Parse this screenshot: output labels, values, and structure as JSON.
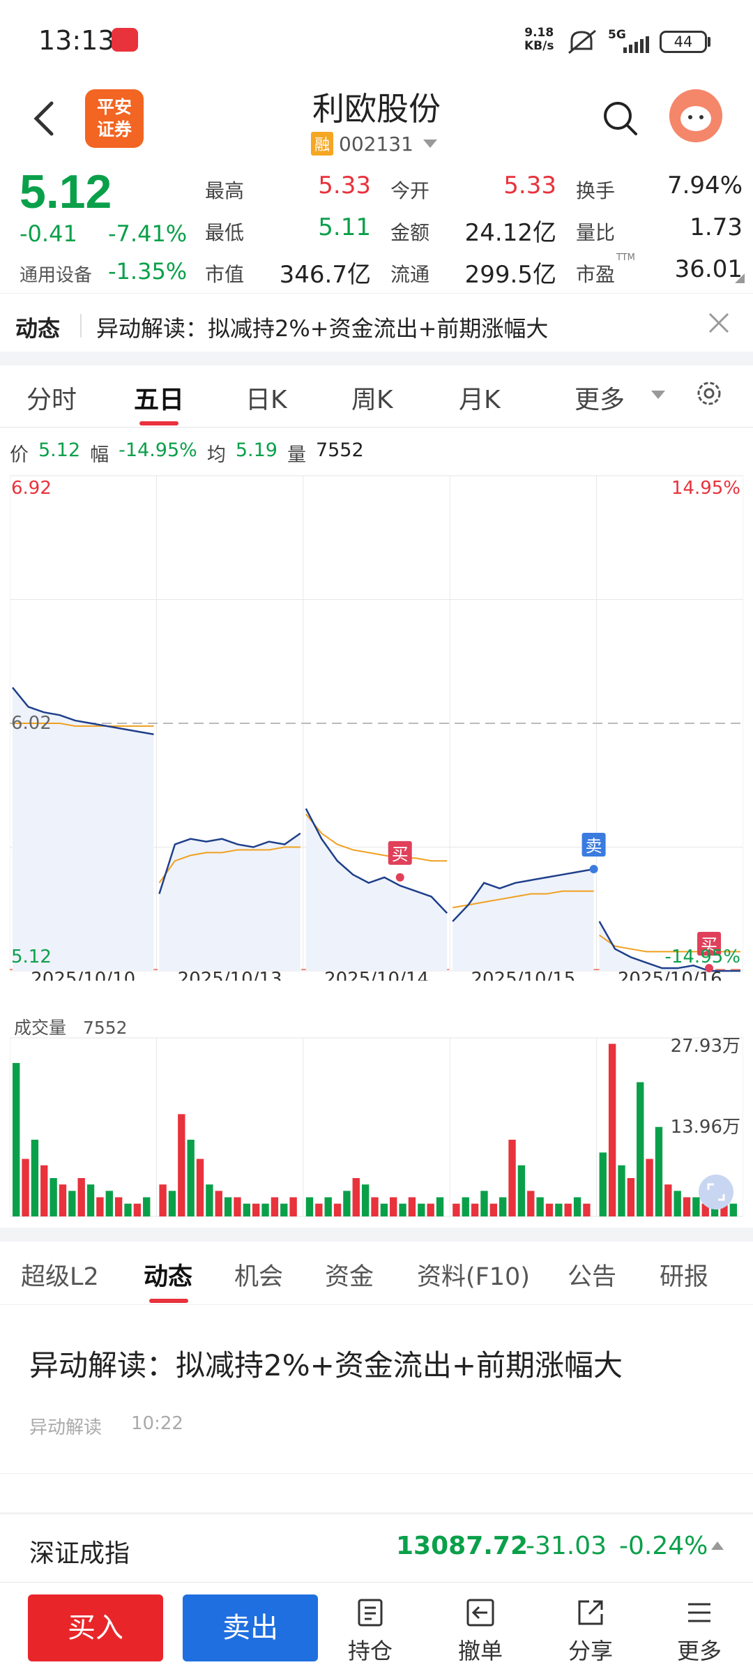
{
  "status": {
    "time": "13:13",
    "net_speed_value": "9.18",
    "net_speed_unit": "KB/s",
    "network": "5G",
    "battery": "44"
  },
  "header": {
    "broker_logo": "平安证券",
    "stock_name": "利欧股份",
    "margin_badge": "融",
    "stock_code": "002131"
  },
  "quote": {
    "price": "5.12",
    "change": "-0.41",
    "change_pct": "-7.41%",
    "sector": "通用设备",
    "sector_pct": "-1.35%",
    "stats": [
      {
        "label": "最高",
        "value": "5.33"
      },
      {
        "label": "今开",
        "value": "5.33"
      },
      {
        "label": "换手",
        "value": "7.94%"
      },
      {
        "label": "最低",
        "value": "5.11"
      },
      {
        "label": "金额",
        "value": "24.12亿"
      },
      {
        "label": "量比",
        "value": "1.73"
      },
      {
        "label": "市值",
        "value": "346.7亿"
      },
      {
        "label": "流通",
        "value": "299.5亿"
      },
      {
        "label": "市盈",
        "value": "36.01"
      }
    ],
    "pe_superscript": "TTM"
  },
  "news_strip": {
    "tag": "动态",
    "text": "异动解读：拟减持2%+资金流出+前期涨幅大"
  },
  "chart_tabs": [
    "分时",
    "五日",
    "日K",
    "周K",
    "月K",
    "更多"
  ],
  "chart_info": {
    "price_label": "价",
    "price": "5.12",
    "range_label": "幅",
    "range": "-14.95%",
    "avg_label": "均",
    "avg": "5.19",
    "vol_label": "量",
    "vol": "7552"
  },
  "colors": {
    "up": "#e8323c",
    "down": "#0aa04a",
    "price_line": "#1e3f8a",
    "avg_line": "#f0a020",
    "buy": "#e8262a",
    "sell": "#1f6fe0"
  },
  "chart_data": [
    {
      "type": "line",
      "title": "",
      "x_labels": [
        "2025/10/10",
        "2025/10/13",
        "2025/10/14",
        "2025/10/15",
        "2025/10/16"
      ],
      "ylim": [
        5.12,
        6.92
      ],
      "y_tick_labels": [
        "6.92",
        "6.02",
        "5.12"
      ],
      "right_tick_labels": [
        "14.95%",
        "-14.95%"
      ],
      "reference_price": 6.02,
      "series": [
        {
          "name": "价",
          "values_by_day": [
            [
              6.15,
              6.08,
              6.06,
              6.05,
              6.03,
              6.02,
              6.01,
              6.0,
              5.99,
              5.98
            ],
            [
              5.4,
              5.58,
              5.6,
              5.59,
              5.6,
              5.58,
              5.57,
              5.59,
              5.58,
              5.62
            ],
            [
              5.71,
              5.6,
              5.52,
              5.47,
              5.44,
              5.46,
              5.43,
              5.41,
              5.39,
              5.33
            ],
            [
              5.3,
              5.36,
              5.44,
              5.42,
              5.44,
              5.45,
              5.46,
              5.47,
              5.48,
              5.49
            ],
            [
              5.3,
              5.2,
              5.17,
              5.15,
              5.13,
              5.13,
              5.14,
              5.12,
              5.12,
              5.12
            ]
          ]
        },
        {
          "name": "均",
          "values_by_day": [
            [
              6.02,
              6.02,
              6.02,
              6.02,
              6.01,
              6.01,
              6.01,
              6.01,
              6.01,
              6.01
            ],
            [
              5.44,
              5.52,
              5.54,
              5.55,
              5.55,
              5.56,
              5.56,
              5.56,
              5.57,
              5.57
            ],
            [
              5.69,
              5.62,
              5.58,
              5.56,
              5.55,
              5.54,
              5.53,
              5.53,
              5.52,
              5.52
            ],
            [
              5.35,
              5.36,
              5.37,
              5.38,
              5.39,
              5.4,
              5.4,
              5.41,
              5.41,
              5.41
            ],
            [
              5.25,
              5.21,
              5.2,
              5.19,
              5.19,
              5.19,
              5.19,
              5.19,
              5.19,
              5.19
            ]
          ]
        }
      ],
      "markers": [
        {
          "label": "买",
          "day": 2,
          "index": 6,
          "value": 5.46
        },
        {
          "label": "卖",
          "day": 3,
          "index": 9,
          "value": 5.49
        },
        {
          "label": "买",
          "day": 4,
          "index": 7,
          "value": 5.13
        }
      ]
    },
    {
      "type": "bar",
      "title": "成交量",
      "current_volume": "7552",
      "y_tick_labels": [
        "27.93万",
        "13.96万"
      ],
      "ylim": [
        0,
        27.93
      ],
      "unit": "万",
      "days": 5,
      "values": [
        [
          24,
          9,
          12,
          8,
          6,
          5,
          4,
          6,
          5,
          3,
          4,
          3,
          2,
          2,
          3
        ],
        [
          5,
          4,
          16,
          12,
          9,
          5,
          4,
          3,
          3,
          2,
          2,
          2,
          3,
          2,
          3
        ],
        [
          3,
          2,
          3,
          2,
          4,
          6,
          5,
          3,
          2,
          3,
          2,
          3,
          2,
          2,
          3
        ],
        [
          2,
          3,
          2,
          4,
          2,
          3,
          12,
          8,
          4,
          3,
          2,
          2,
          2,
          3,
          2
        ],
        [
          10,
          27,
          8,
          6,
          21,
          9,
          14,
          5,
          4,
          3,
          3,
          2,
          3,
          2,
          2
        ]
      ]
    }
  ],
  "bottom_tabs": [
    "超级L2",
    "动态",
    "机会",
    "资金",
    "资料(F10)",
    "公告",
    "研报"
  ],
  "news": {
    "title": "异动解读：拟减持2%+资金流出+前期涨幅大",
    "source": "异动解读",
    "time": "10:22"
  },
  "index_bar": {
    "name": "深证成指",
    "value": "13087.72",
    "change": "-31.03",
    "pct": "-0.24%"
  },
  "toolbar": {
    "buy": "买入",
    "sell": "卖出",
    "position": "持仓",
    "cancel": "撤单",
    "share": "分享",
    "more": "更多"
  }
}
